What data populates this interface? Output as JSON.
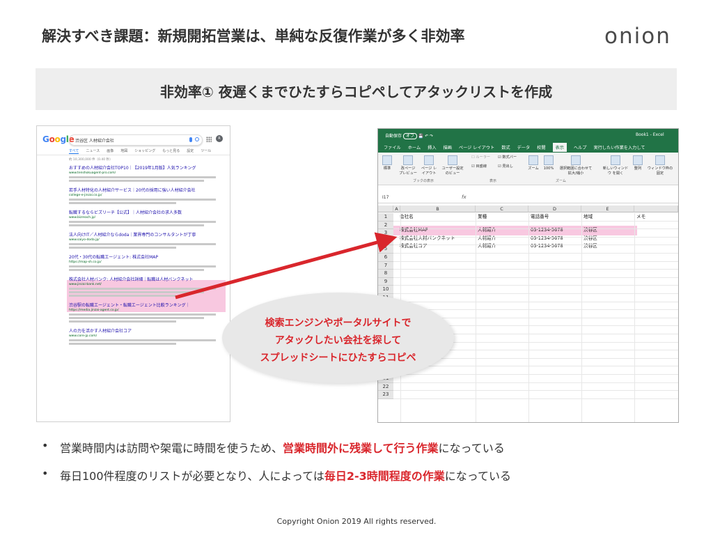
{
  "header": {
    "title": "解決すべき課題：新規開拓営業は、単純な反復作業が多く非効率",
    "logo": "onion"
  },
  "banner": {
    "text": "非効率① 夜遅くまでひたすらコピペしてアタックリストを作成"
  },
  "google": {
    "logo_letters": [
      "G",
      "o",
      "o",
      "g",
      "l",
      "e"
    ],
    "logo_colors": [
      "#4285f4",
      "#ea4335",
      "#fbbc05",
      "#4285f4",
      "#34a853",
      "#ea4335"
    ],
    "query": "渋谷区 人材紹介会社",
    "avatar": "R",
    "tabs": [
      "すべて",
      "ニュース",
      "画像",
      "地図",
      "ショッピング",
      "もっと見る",
      "設定",
      "ツール"
    ],
    "result_count": "約 10,300,000 件（0.40 秒）",
    "results": [
      {
        "title": "おすすめの人材紹介会社TOP10｜【2019年1月版】人気ランキング",
        "url": "www.tenshokuagent-pro.com/"
      },
      {
        "title": "若手人材特化の人材紹介サービス｜20代の採用に強い人材紹介会社",
        "url": "college-e-jinzai.co.jp/"
      },
      {
        "title": "転職するならビズリーチ【公式】｜人材紹介会社の求人多数",
        "url": "www.bizreach.jp/"
      },
      {
        "title": "法人向けIT／人材紹介ならdoda｜業界専門のコンサルタントが丁寧",
        "url": "www.saiyo-doda.jp/"
      },
      {
        "title": "20代・30代の転職エージェント: 株式会社MAP",
        "url": "https://map-sh.co.jp/"
      },
      {
        "title": "株式会社人材バンク: 人材紹介会社詳細｜転職は人材バンクネット",
        "url": "www.jinzai-bank.net/"
      },
      {
        "title": "渋谷駅の転職エージェント・転職エージェント比較ランキング｜",
        "url": "https://media.jinzai-agent.co.jp/"
      },
      {
        "title": "人の力を活かす人材紹介会社コア",
        "url": "www.core-jp.com/"
      }
    ]
  },
  "excel": {
    "autosave": "自動保存",
    "autosave_state": "オフ",
    "workbook": "Book1 - Excel",
    "tabs": [
      "ファイル",
      "ホーム",
      "挿入",
      "描画",
      "ページ レイアウト",
      "数式",
      "データ",
      "校閲",
      "表示",
      "ヘルプ"
    ],
    "selected_tab": "表示",
    "tell_me": "実行したい作業を入力して",
    "ribbon": {
      "standard": "標準",
      "page_break": "改ページ プレビュー",
      "page_layout": "ページ レイアウト",
      "custom_view": "ユーザー設定 のビュー",
      "group_view": "ブックの表示",
      "ruler": "ルーラー",
      "formula_bar": "数式バー",
      "gridlines": "目盛線",
      "headings": "見出し",
      "group_show": "表示",
      "zoom": "ズーム",
      "zoom100": "100%",
      "zoom_sel": "選択範囲に合わせて 拡大/縮小",
      "group_zoom": "ズーム",
      "new_window": "新しいウィンドウ を開く",
      "arrange": "整列",
      "freeze": "ウィンドウ枠の 固定"
    },
    "name_box": "I17",
    "fx": "fx",
    "columns": [
      "A",
      "B",
      "C",
      "D",
      "E"
    ],
    "rows": [
      "1",
      "2",
      "3",
      "4",
      "5",
      "6",
      "7",
      "8",
      "9",
      "10",
      "11",
      "12",
      "13",
      "14",
      "15",
      "16",
      "17",
      "18",
      "19",
      "20",
      "21",
      "22",
      "23"
    ],
    "header_row": [
      "会社名",
      "業種",
      "電話番号",
      "地域",
      "メモ"
    ],
    "data_rows": [
      [
        "株式会社MAP",
        "人材紹介",
        "03-1234-5678",
        "渋谷区"
      ],
      [
        "株式会社人材バンクネット",
        "人材紹介",
        "03-1234-5678",
        "渋谷区"
      ],
      [
        "株式会社コア",
        "人材紹介",
        "03-1234-5678",
        "渋谷区"
      ]
    ]
  },
  "callout": {
    "lines": [
      "検索エンジンやポータルサイトで",
      "アタックしたい会社を探して",
      "スプレッドシートにひたすらコピペ"
    ]
  },
  "bullets": [
    {
      "bullet": "•",
      "pre": "営業時間内は訪問や架電に時間を使うため、",
      "em": "営業時間外に残業して行う作業",
      "post": "になっている"
    },
    {
      "bullet": "•",
      "pre": "毎日100件程度のリストが必要となり、人によっては",
      "em": "毎日2-3時間程度の作業",
      "post": "になっている"
    }
  ],
  "footer": {
    "copyright": "Copyright Onion 2019 All rights reserved."
  },
  "colors": {
    "accent_red": "#d9262c",
    "highlight_pink": "#f8c8e0",
    "excel_green": "#217346"
  }
}
